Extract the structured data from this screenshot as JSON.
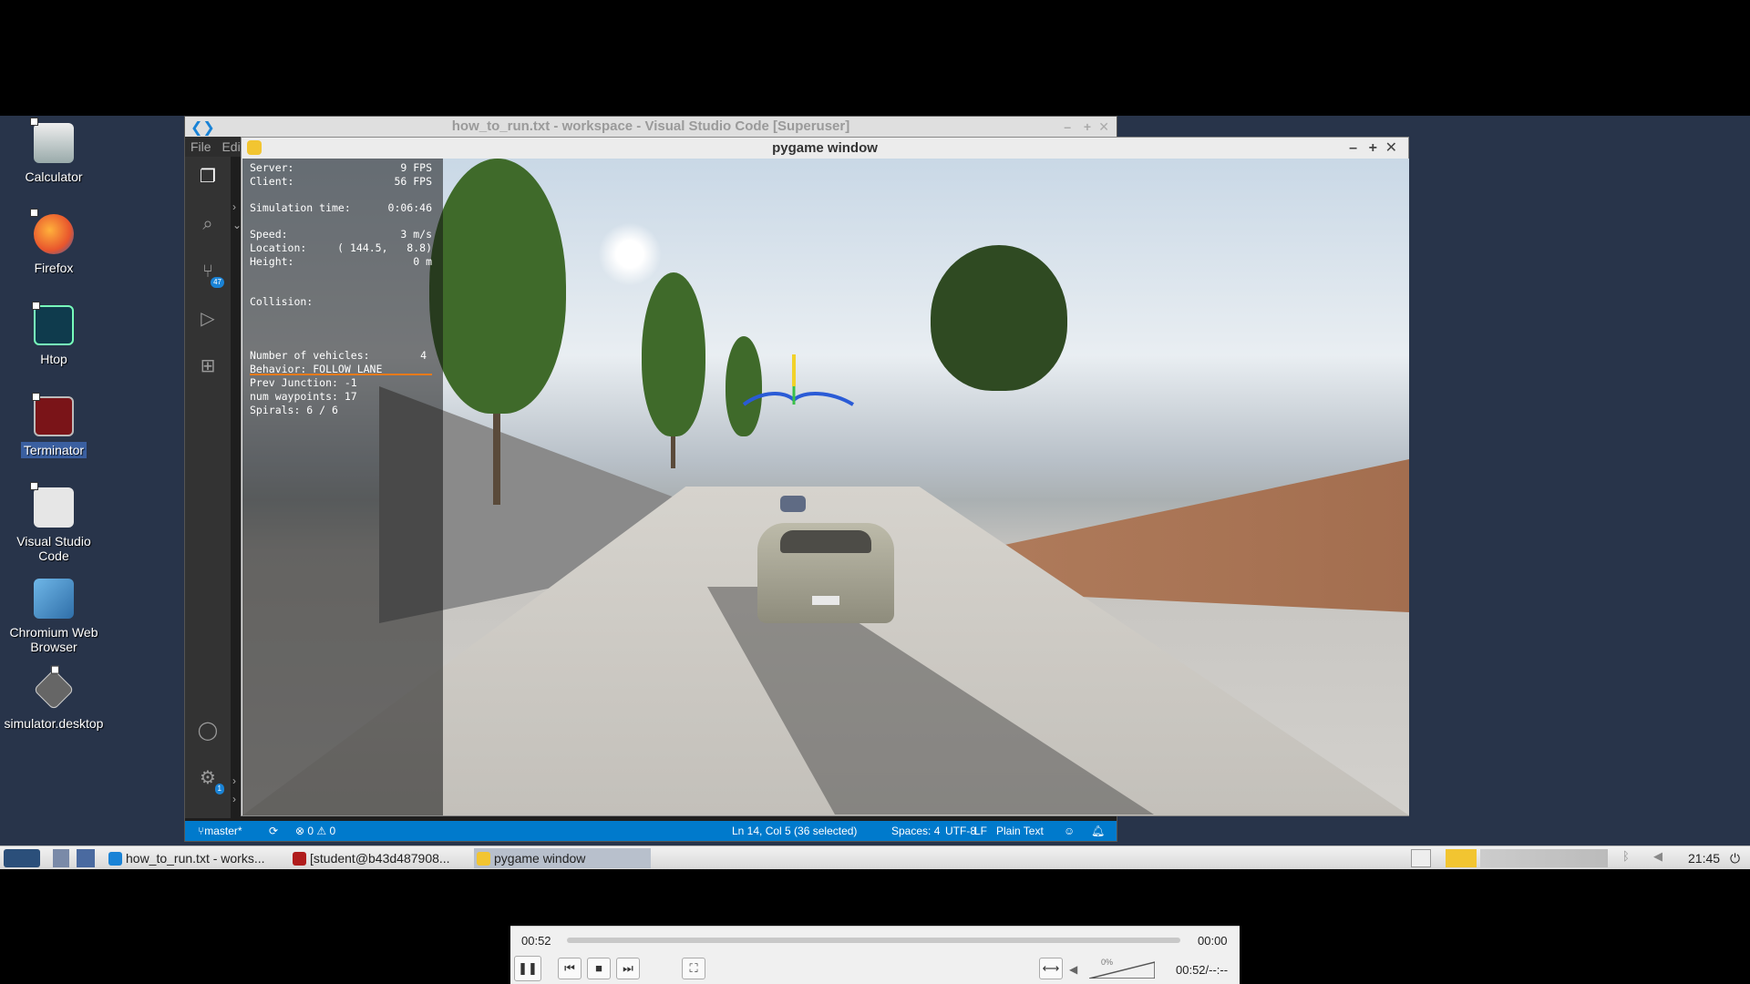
{
  "desktop": {
    "icons": [
      {
        "label": "Calculator",
        "name": "calculator-icon"
      },
      {
        "label": "Firefox",
        "name": "firefox-icon"
      },
      {
        "label": "Htop",
        "name": "htop-icon"
      },
      {
        "label": "Terminator",
        "name": "terminator-icon"
      },
      {
        "label": "Visual Studio Code",
        "name": "vscode-icon"
      },
      {
        "label": "Chromium Web Browser",
        "name": "chromium-icon"
      },
      {
        "label": "simulator.desktop",
        "name": "simulator-desktop-icon"
      }
    ]
  },
  "vscode": {
    "title": "how_to_run.txt - workspace - Visual Studio Code [Superuser]",
    "menu_file": "File",
    "menu_edit": "Edi",
    "scm_badge": "47",
    "settings_badge": "1",
    "status": {
      "branch": "master*",
      "problems": "⊗ 0 ⚠ 0",
      "cursor": "Ln 14, Col 5 (36 selected)",
      "spaces": "Spaces: 4",
      "encoding": "UTF-8",
      "eol": "LF",
      "language": "Plain Text"
    }
  },
  "pygame": {
    "title": "pygame window",
    "hud": {
      "server_label": "Server:",
      "server_value": "9 FPS",
      "client_label": "Client:",
      "client_value": "56 FPS",
      "simtime_label": "Simulation time:",
      "simtime_value": "0:06:46",
      "speed_label": "Speed:",
      "speed_value": "3 m/s",
      "location_label": "Location:",
      "location_value": "( 144.5,   8.8)",
      "height_label": "Height:",
      "height_value": "0 m",
      "collision_label": "Collision:",
      "vehicles_label": "Number of vehicles:",
      "vehicles_value": "4",
      "behavior": "Behavior: FOLLOW LANE",
      "junction": "Prev Junction: -1",
      "waypoints": "num waypoints: 17",
      "spirals": "Spirals: 6 / 6"
    }
  },
  "taskbar": {
    "items": [
      {
        "label": "how_to_run.txt - works...",
        "color": "#1a83d6"
      },
      {
        "label": "[student@b43d487908...",
        "color": "#b01c1c"
      },
      {
        "label": "pygame window",
        "color": "#f2c531"
      }
    ],
    "clock": "21:45"
  },
  "player": {
    "elapsed": "00:52",
    "total": "00:00",
    "position": "00:52/--:--",
    "volume": "0%",
    "progress": 0
  }
}
